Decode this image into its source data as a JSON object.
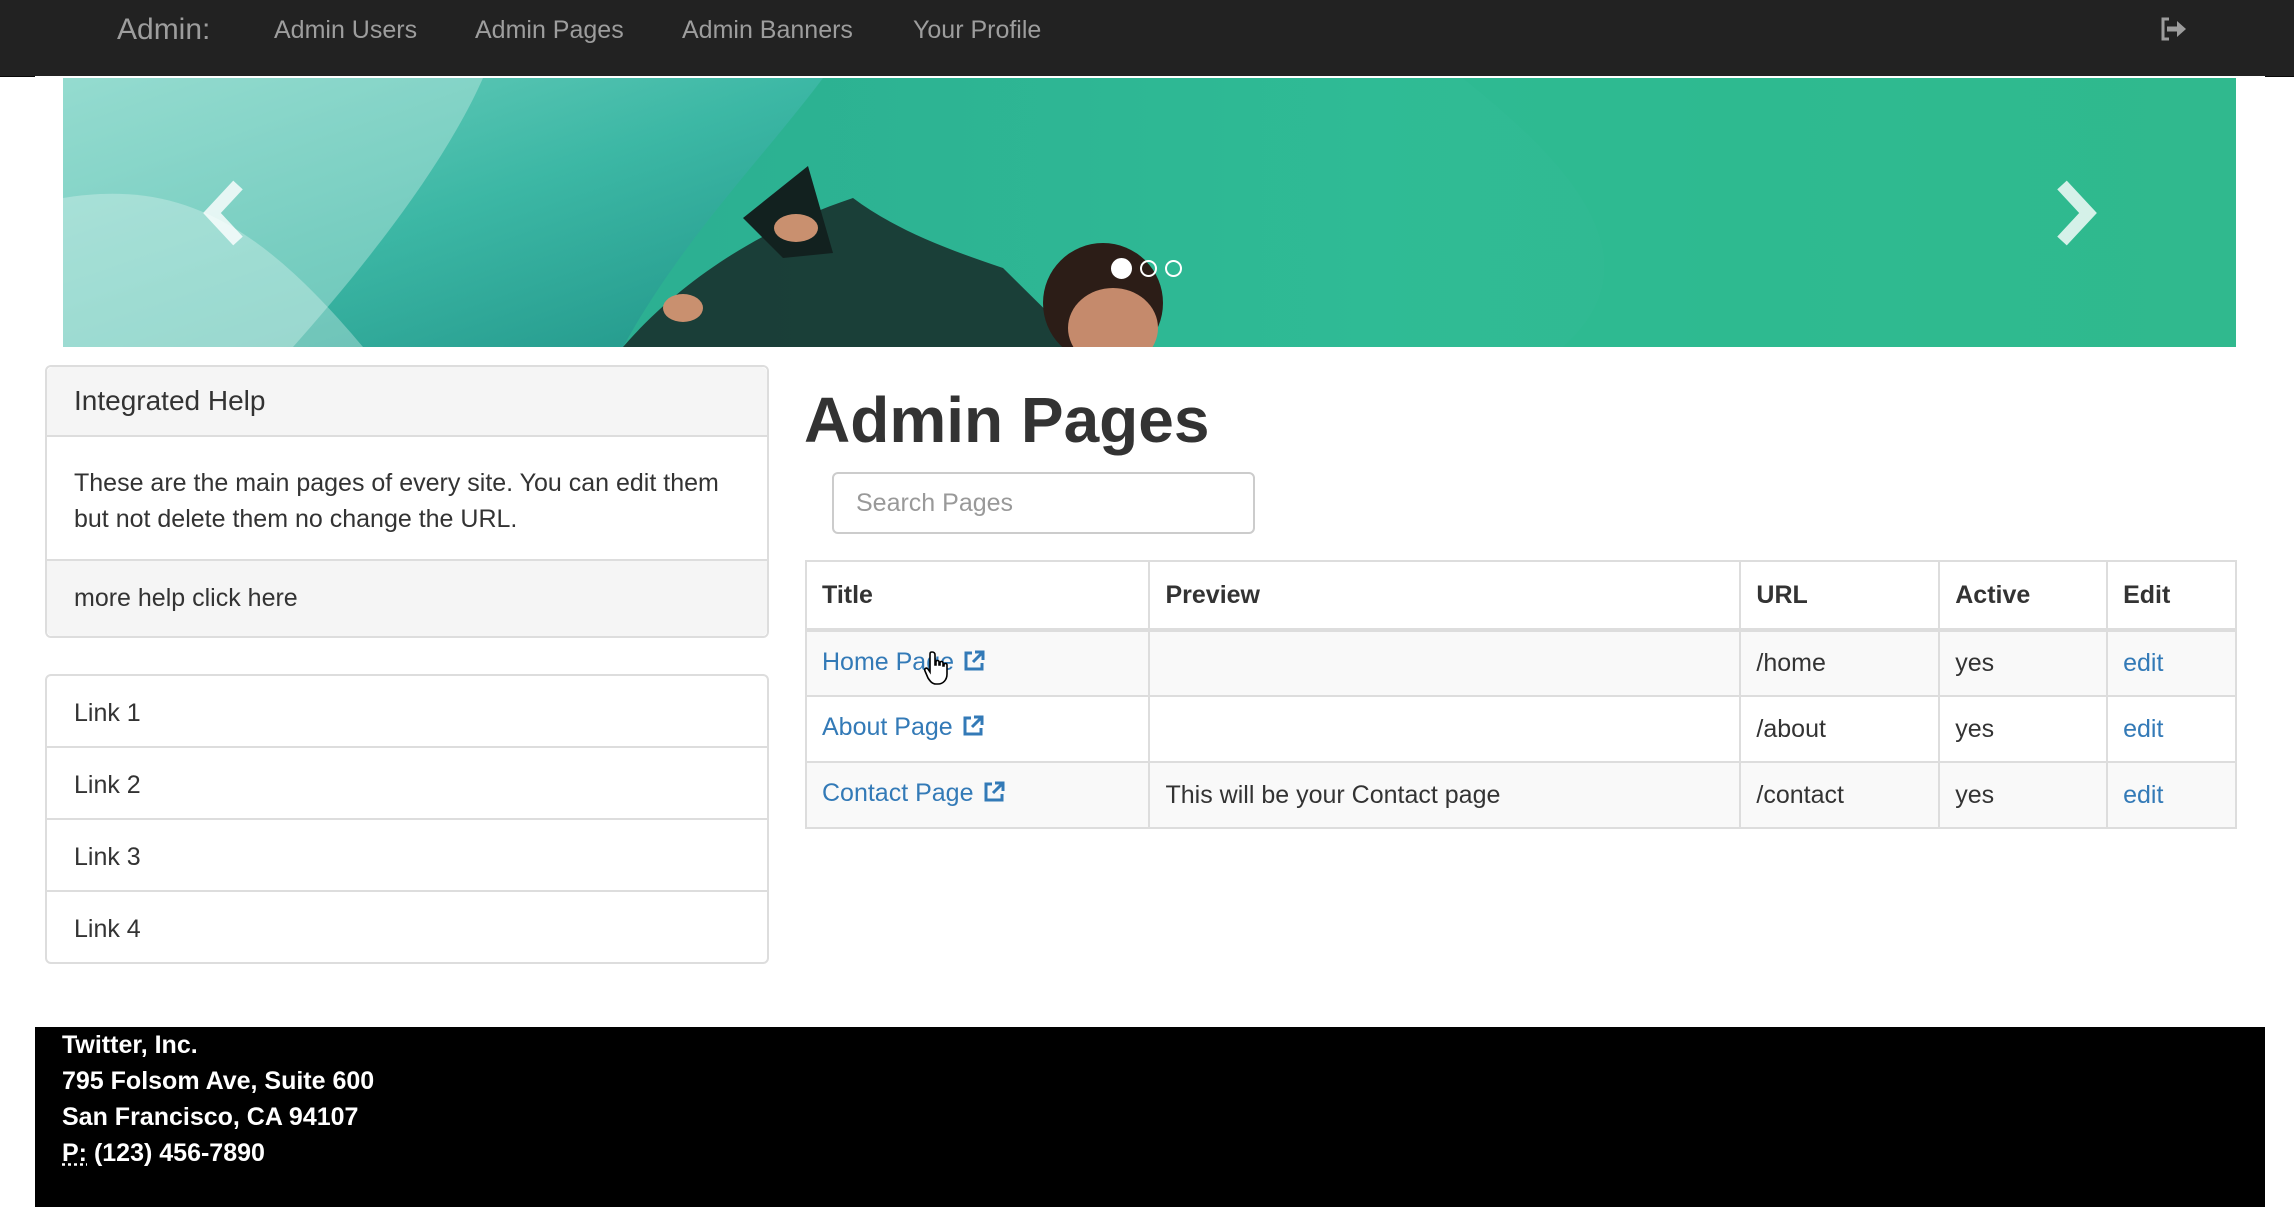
{
  "navbar": {
    "brand": "Admin:",
    "items": [
      {
        "label": "Admin Users"
      },
      {
        "label": "Admin Pages"
      },
      {
        "label": "Admin Banners"
      },
      {
        "label": "Your Profile"
      }
    ],
    "logout_icon": "sign-out-icon"
  },
  "carousel": {
    "indicators": 3,
    "active_index": 0,
    "prev_icon": "chevron-left-icon",
    "next_icon": "chevron-right-icon"
  },
  "help_panel": {
    "heading": "Integrated Help",
    "body": "These are the main pages of every site. You can edit them but not delete them no change the URL.",
    "footer": "more help click here"
  },
  "links": [
    "Link 1",
    "Link 2",
    "Link 3",
    "Link 4"
  ],
  "main": {
    "title": "Admin Pages",
    "search_placeholder": "Search Pages",
    "table": {
      "headers": [
        "Title",
        "Preview",
        "URL",
        "Active",
        "Edit"
      ],
      "rows": [
        {
          "title": "Home Page",
          "preview": "",
          "url": "/home",
          "active": "yes",
          "edit": "edit"
        },
        {
          "title": "About Page",
          "preview": "",
          "url": "/about",
          "active": "yes",
          "edit": "edit"
        },
        {
          "title": "Contact Page",
          "preview": "This will be your Contact page",
          "url": "/contact",
          "active": "yes",
          "edit": "edit"
        }
      ]
    }
  },
  "footer": {
    "company": "Twitter, Inc.",
    "street": "795 Folsom Ave, Suite 600",
    "city": "San Francisco, CA 94107",
    "phone_label": "P:",
    "phone": "(123) 456-7890"
  },
  "colors": {
    "navbar_bg": "#222222",
    "navbar_text": "#9d9d9d",
    "link": "#337ab7",
    "footer_bg": "#000000"
  }
}
